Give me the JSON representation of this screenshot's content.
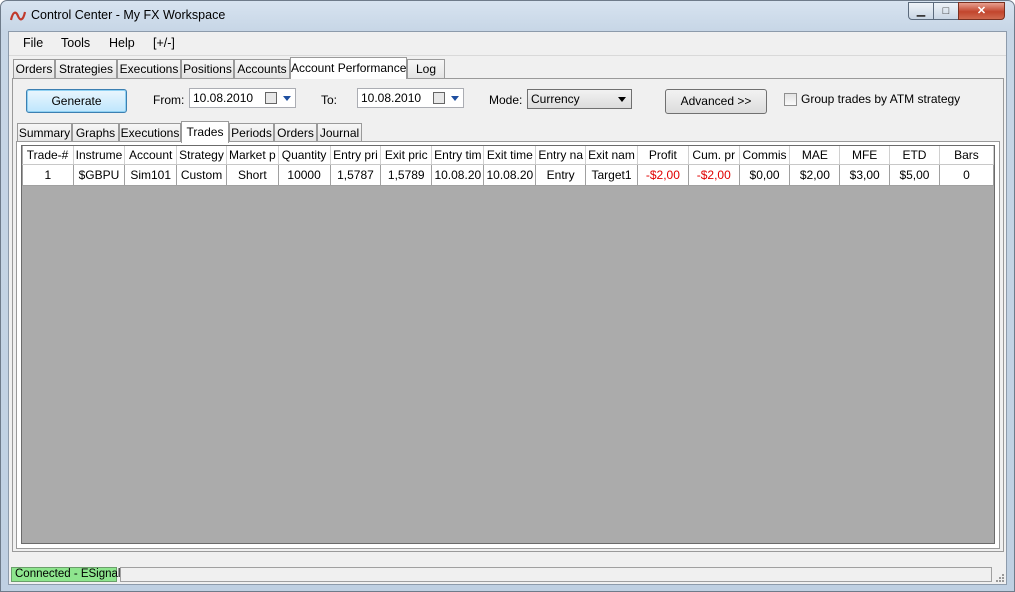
{
  "window": {
    "title": "Control Center - My FX Workspace",
    "minimize_glyph": "▁",
    "maximize_glyph": "□",
    "close_glyph": "✕"
  },
  "menu": [
    {
      "label": "File"
    },
    {
      "label": "Tools"
    },
    {
      "label": "Help"
    },
    {
      "label": "[+/-]"
    }
  ],
  "main_tabs": [
    "Orders",
    "Strategies",
    "Executions",
    "Positions",
    "Accounts",
    "Account Performance",
    "Log"
  ],
  "main_active_tab": "Account Performance",
  "toolbar": {
    "generate_label": "Generate",
    "from_label": "From:",
    "from_value": "10.08.2010",
    "to_label": "To:",
    "to_value": "10.08.2010",
    "mode_label": "Mode:",
    "mode_value": "Currency",
    "advanced_label": "Advanced >>",
    "group_checkbox_label": "Group trades by ATM strategy",
    "group_checked": false
  },
  "sub_tabs": [
    "Summary",
    "Graphs",
    "Executions",
    "Trades",
    "Periods",
    "Orders",
    "Journal"
  ],
  "sub_active_tab": "Trades",
  "trades_table": {
    "columns": [
      "Trade-#",
      "Instrume",
      "Account",
      "Strategy",
      "Market p",
      "Quantity",
      "Entry pri",
      "Exit pric",
      "Entry tim",
      "Exit time",
      "Entry na",
      "Exit nam",
      "Profit",
      "Cum. pr",
      "Commis",
      "MAE",
      "MFE",
      "ETD",
      "Bars"
    ],
    "rows": [
      [
        "1",
        "$GBPU",
        "Sim101",
        "Custom",
        "Short",
        "10000",
        "1,5787",
        "1,5789",
        "10.08.20",
        "10.08.20",
        "Entry",
        "Target1",
        "-$2,00",
        "-$2,00",
        "$0,00",
        "$2,00",
        "$3,00",
        "$5,00",
        "0"
      ]
    ]
  },
  "status": {
    "connection": "Connected - ESignal"
  },
  "colors": {
    "negative": "#e00000",
    "connected_bg": "#8ee58e",
    "grid_empty": "#ababab"
  }
}
